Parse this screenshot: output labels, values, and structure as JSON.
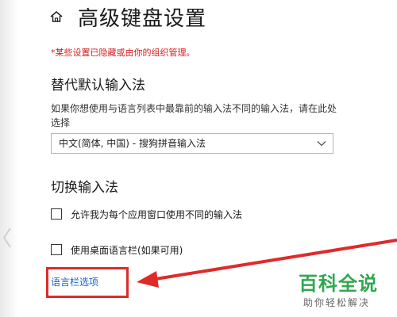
{
  "header": {
    "title": "高级键盘设置",
    "home_icon": "home-icon"
  },
  "notice": {
    "text": "*某些设置已隐藏或由你的组织管理。",
    "color": "#d22020"
  },
  "override_section": {
    "title": "替代默认输入法",
    "description": "如果你想使用与语言列表中最靠前的输入法不同的输入法，请在此处选择",
    "dropdown": {
      "selected": "中文(简体, 中国) - 搜狗拼音输入法"
    }
  },
  "switch_section": {
    "title": "切换输入法",
    "checkboxes": [
      {
        "label": "允许我为每个应用窗口使用不同的输入法",
        "checked": false
      },
      {
        "label": "使用桌面语言栏(如果可用)",
        "checked": false
      }
    ],
    "link": {
      "label": "语言栏选项",
      "color": "#1264c8"
    }
  },
  "annotation": {
    "color": "#e02a2a"
  },
  "watermark": {
    "main": "百科全说",
    "sub": "助你轻松解决",
    "color": "#2fa84f"
  }
}
